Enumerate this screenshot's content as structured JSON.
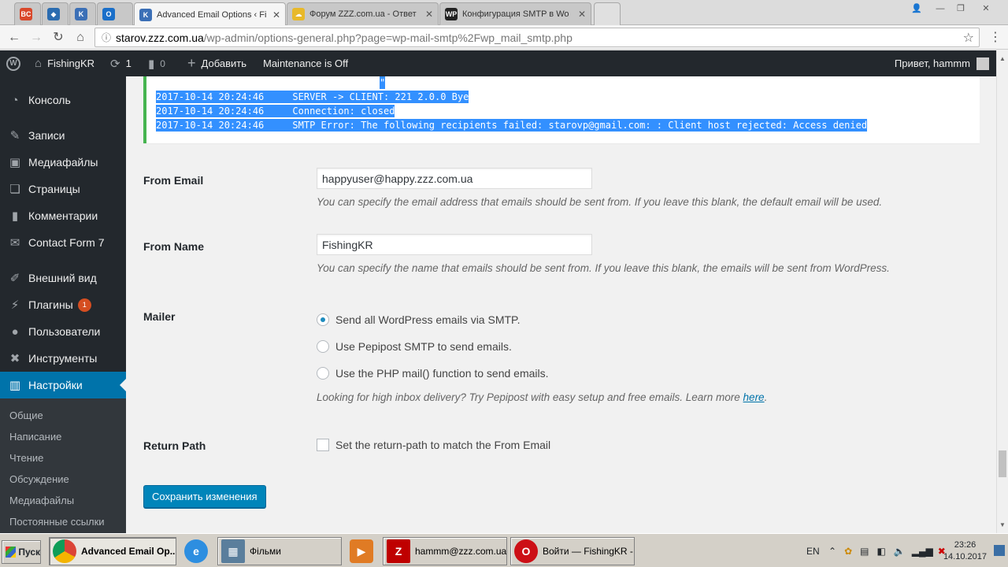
{
  "browser": {
    "tabs": [
      {
        "favicon": "BC",
        "title": "",
        "color": "#d9482b"
      },
      {
        "favicon": "",
        "title": "",
        "color": "#2b6cb0"
      },
      {
        "favicon": "K",
        "title": "",
        "color": "#3b6fb6"
      },
      {
        "favicon": "O",
        "title": "",
        "color": "#1a6fc9"
      },
      {
        "favicon": "K",
        "title": "Advanced Email Options ‹ Fi",
        "color": "#3b6fb6"
      },
      {
        "favicon": "",
        "title": "Форум ZZZ.com.ua - Ответ",
        "color": "#e8b92a"
      },
      {
        "favicon": "WP",
        "title": "Конфигурация SMTP в Wo",
        "color": "#222"
      }
    ],
    "url_host": "starov.zzz.com.ua",
    "url_path": "/wp-admin/options-general.php?page=wp-mail-smtp%2Fwp_mail_smtp.php"
  },
  "adminbar": {
    "site_name": "FishingKR",
    "updates_count": "1",
    "comments_count": "0",
    "add_new": "Добавить",
    "maintenance": "Maintenance is Off",
    "greeting": "Привет, hammm"
  },
  "sidebar": {
    "items": [
      {
        "label": "Консоль",
        "icon": "dashboard-icon"
      },
      {
        "label": "Записи",
        "icon": "pin-icon"
      },
      {
        "label": "Медиафайлы",
        "icon": "media-icon"
      },
      {
        "label": "Страницы",
        "icon": "pages-icon"
      },
      {
        "label": "Комментарии",
        "icon": "comments-icon"
      },
      {
        "label": "Contact Form 7",
        "icon": "mail-icon"
      },
      {
        "label": "Внешний вид",
        "icon": "brush-icon"
      },
      {
        "label": "Плагины",
        "icon": "plugin-icon",
        "badge": "1"
      },
      {
        "label": "Пользователи",
        "icon": "users-icon"
      },
      {
        "label": "Инструменты",
        "icon": "tools-icon"
      },
      {
        "label": "Настройки",
        "icon": "settings-icon"
      }
    ],
    "submenu": [
      "Общие",
      "Написание",
      "Чтение",
      "Обсуждение",
      "Медиафайлы",
      "Постоянные ссылки"
    ]
  },
  "debug_log": {
    "quote_char": "\"",
    "lines": [
      "2017-10-14 20:24:46     SERVER -> CLIENT: 221 2.0.0 Bye",
      "2017-10-14 20:24:46     Connection: closed",
      "2017-10-14 20:24:46     SMTP Error: The following recipients failed: starovp@gmail.com: : Client host rejected: Access denied"
    ]
  },
  "form": {
    "from_email": {
      "label": "From Email",
      "value": "happyuser@happy.zzz.com.ua",
      "description": "You can specify the email address that emails should be sent from. If you leave this blank, the default email will be used."
    },
    "from_name": {
      "label": "From Name",
      "value": "FishingKR",
      "description": "You can specify the name that emails should be sent from. If you leave this blank, the emails will be sent from WordPress."
    },
    "mailer": {
      "label": "Mailer",
      "options": [
        "Send all WordPress emails via SMTP.",
        "Use Pepipost SMTP to send emails.",
        "Use the PHP mail() function to send emails."
      ],
      "selected_index": 0,
      "promo_text": "Looking for high inbox delivery? Try Pepipost with easy setup and free emails. Learn more ",
      "promo_link": "here",
      "promo_end": "."
    },
    "return_path": {
      "label": "Return Path",
      "checkbox_label": "Set the return-path to match the From Email"
    },
    "save_label": "Сохранить изменения"
  },
  "taskbar": {
    "start_label": "Пуск",
    "tasks": [
      "Advanced Email Op...",
      "Фільми",
      "hammm@zzz.com.ua ...",
      "Войти — FishingKR - ..."
    ],
    "lang": "EN",
    "time": "23:26",
    "date": "14.10.2017"
  },
  "colors": {
    "wp_dark": "#23282d",
    "wp_blue": "#0073aa",
    "log_highlight": "#3390ff",
    "success_border": "#46b450"
  }
}
